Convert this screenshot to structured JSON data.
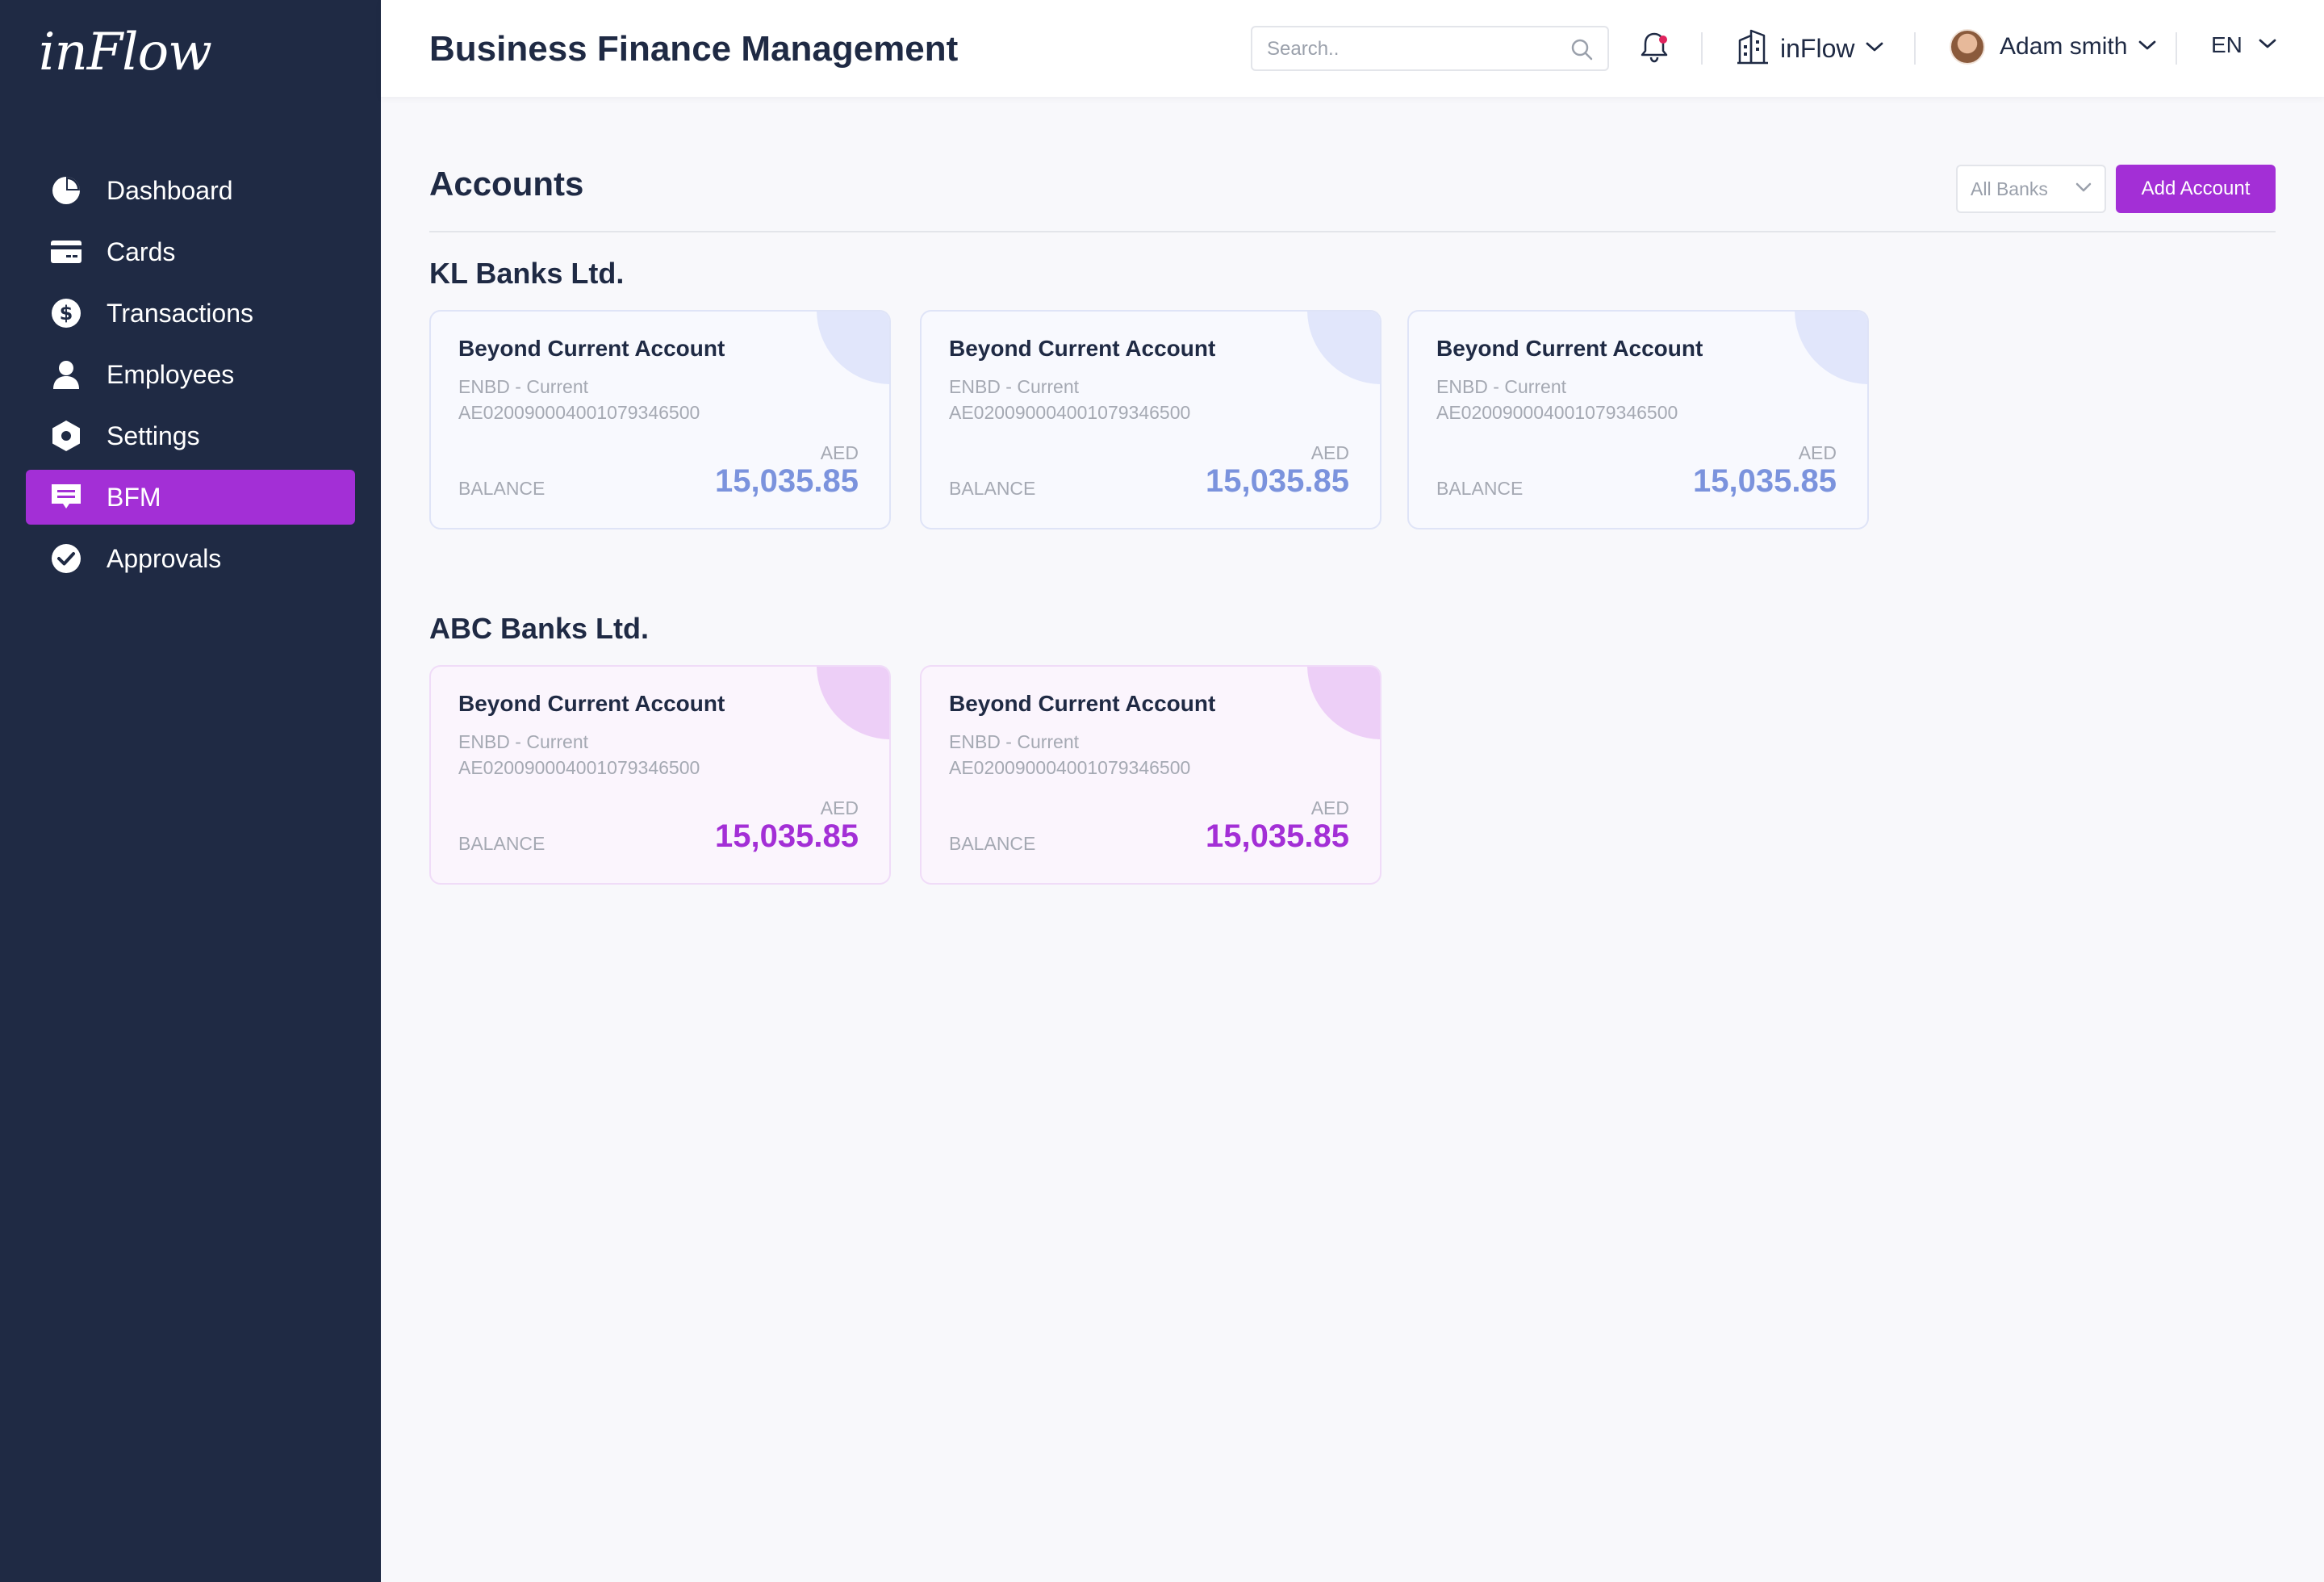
{
  "app": {
    "logo_text": "inFlow",
    "colors": {
      "sidebar": "#1f2a44",
      "accent": "#a32fd6",
      "blue_amount": "#7b93dd",
      "purple_amount": "#a32fd6",
      "notification_dot": "#e0245e"
    }
  },
  "sidebar": {
    "items": [
      {
        "label": "Dashboard",
        "icon": "pie-chart-icon",
        "active": false
      },
      {
        "label": "Cards",
        "icon": "credit-card-icon",
        "active": false
      },
      {
        "label": "Transactions",
        "icon": "dollar-icon",
        "active": false
      },
      {
        "label": "Employees",
        "icon": "user-icon",
        "active": false
      },
      {
        "label": "Settings",
        "icon": "hexagon-gear-icon",
        "active": false
      },
      {
        "label": "BFM",
        "icon": "message-icon",
        "active": true
      },
      {
        "label": "Approvals",
        "icon": "check-circle-icon",
        "active": false
      }
    ]
  },
  "header": {
    "title": "Business Finance Management",
    "search_placeholder": "Search..",
    "company": "inFlow",
    "user": "Adam smith",
    "language": "EN"
  },
  "main": {
    "section_title": "Accounts",
    "bank_filter": "All Banks",
    "add_button": "Add Account",
    "banks": [
      {
        "name": "KL Banks Ltd.",
        "theme": "blue",
        "accounts": [
          {
            "title": "Beyond Current Account",
            "subtitle": "ENBD - Current",
            "iban": "AE020090004001079346500",
            "currency": "AED",
            "balance_label": "BALANCE",
            "amount": "15,035.85"
          },
          {
            "title": "Beyond Current Account",
            "subtitle": "ENBD - Current",
            "iban": "AE020090004001079346500",
            "currency": "AED",
            "balance_label": "BALANCE",
            "amount": "15,035.85"
          },
          {
            "title": "Beyond Current Account",
            "subtitle": "ENBD - Current",
            "iban": "AE020090004001079346500",
            "currency": "AED",
            "balance_label": "BALANCE",
            "amount": "15,035.85"
          }
        ]
      },
      {
        "name": "ABC Banks Ltd.",
        "theme": "purple",
        "accounts": [
          {
            "title": "Beyond Current Account",
            "subtitle": "ENBD - Current",
            "iban": "AE020090004001079346500",
            "currency": "AED",
            "balance_label": "BALANCE",
            "amount": "15,035.85"
          },
          {
            "title": "Beyond Current Account",
            "subtitle": "ENBD - Current",
            "iban": "AE020090004001079346500",
            "currency": "AED",
            "balance_label": "BALANCE",
            "amount": "15,035.85"
          }
        ]
      }
    ]
  }
}
